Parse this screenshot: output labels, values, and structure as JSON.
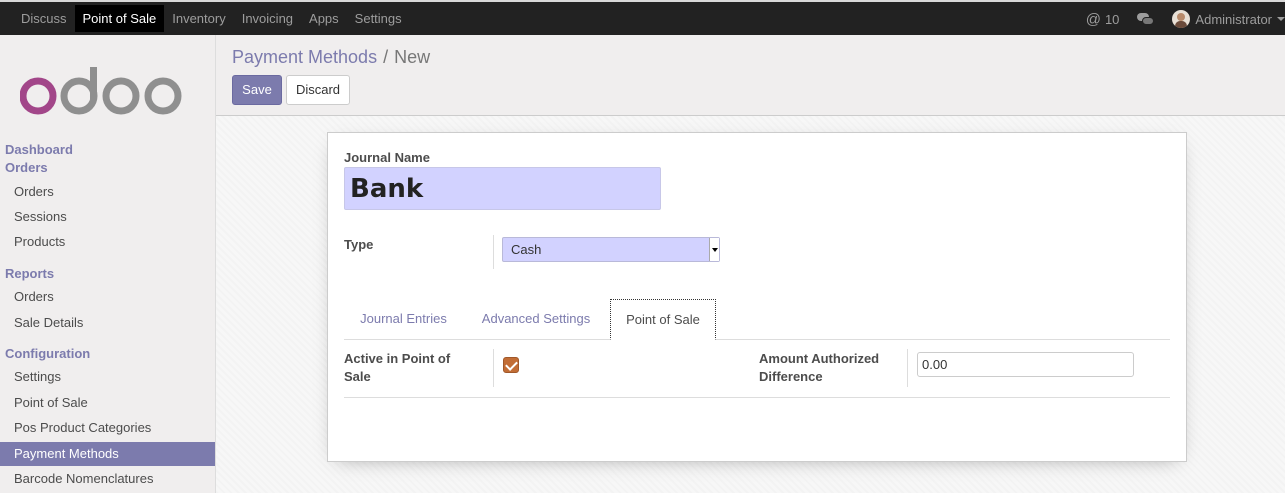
{
  "topbar": {
    "menu": [
      "Discuss",
      "Point of Sale",
      "Inventory",
      "Invoicing",
      "Apps",
      "Settings"
    ],
    "active_menu": "Point of Sale",
    "messages_count": "10",
    "user_name": "Administrator"
  },
  "sidebar": {
    "dashboard": "Dashboard",
    "orders_head": "Orders",
    "orders_items": [
      "Orders",
      "Sessions",
      "Products"
    ],
    "reports_head": "Reports",
    "reports_items": [
      "Orders",
      "Sale Details"
    ],
    "config_head": "Configuration",
    "config_items": [
      "Settings",
      "Point of Sale",
      "Pos Product Categories",
      "Payment Methods",
      "Barcode Nomenclatures"
    ],
    "active_item": "Payment Methods"
  },
  "breadcrumb": {
    "parent": "Payment Methods",
    "sep": "/",
    "current": "New"
  },
  "buttons": {
    "save": "Save",
    "discard": "Discard"
  },
  "form": {
    "journal_name_label": "Journal Name",
    "journal_name_value": "Bank",
    "type_label": "Type",
    "type_value": "Cash",
    "tabs": [
      "Journal Entries",
      "Advanced Settings",
      "Point of Sale"
    ],
    "active_tab": "Point of Sale",
    "active_pos_label": "Active in Point of Sale",
    "active_pos_checked": true,
    "amount_label": "Amount Authorized Difference",
    "amount_value": "0.00"
  },
  "colors": {
    "accent": "#7c7bad",
    "logo_o": "#a24689",
    "logo_doo": "#8f8f8f",
    "checkbox": "#c26d35",
    "input_bg": "#d2d2ff"
  }
}
